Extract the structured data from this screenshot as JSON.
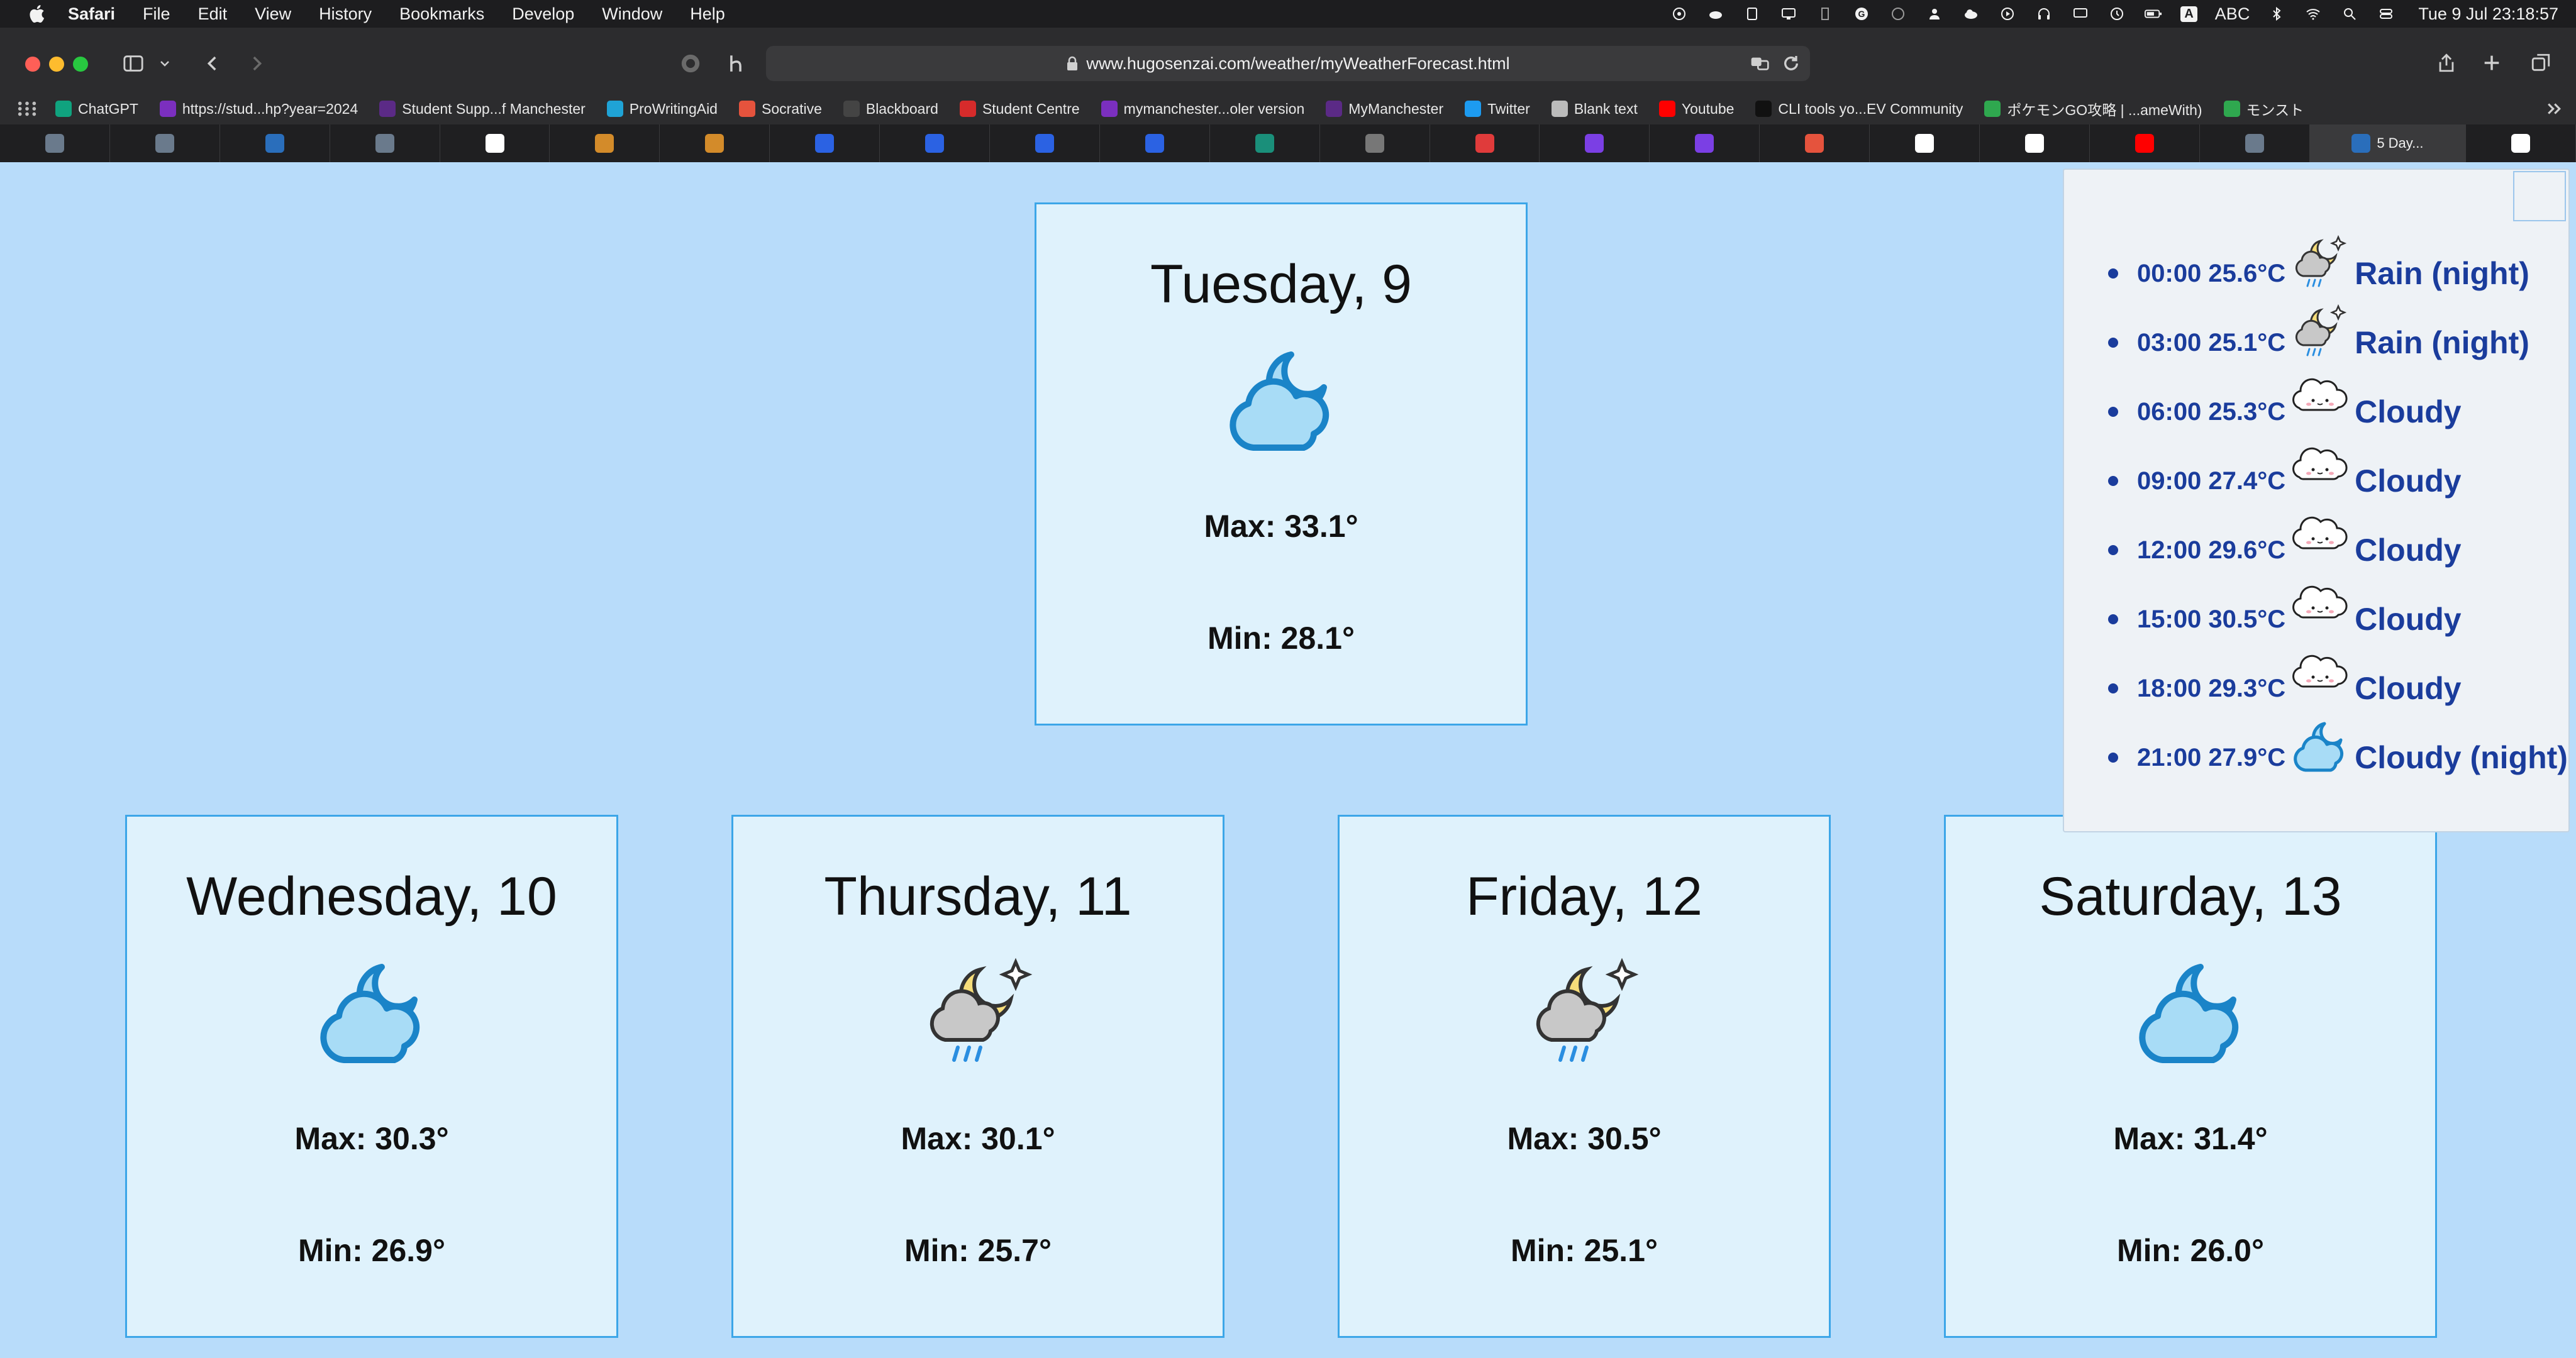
{
  "menubar": {
    "app_name": "Safari",
    "items": [
      "File",
      "Edit",
      "View",
      "History",
      "Bookmarks",
      "Develop",
      "Window",
      "Help"
    ],
    "input_source": "ABC",
    "clock": "Tue 9 Jul  23:18:57"
  },
  "browser": {
    "url": "www.hugosenzai.com/weather/myWeatherForecast.html",
    "active_tab_title": "5 Day..."
  },
  "bookmarks": [
    {
      "label": "ChatGPT",
      "icon": "chatgpt-icon",
      "color": "#10a37f"
    },
    {
      "label": "https://stud...hp?year=2024",
      "icon": "moodle-icon",
      "color": "#7b2fbf"
    },
    {
      "label": "Student Supp...f Manchester",
      "icon": "mymanchester-icon",
      "color": "#5b2a86"
    },
    {
      "label": "ProWritingAid",
      "icon": "prowritingaid-icon",
      "color": "#1fa3d6"
    },
    {
      "label": "Socrative",
      "icon": "socrative-icon",
      "color": "#e5533d"
    },
    {
      "label": "Blackboard",
      "icon": "blackboard-icon",
      "color": "#444444"
    },
    {
      "label": "Student Centre",
      "icon": "student-centre-icon",
      "color": "#d62b2b"
    },
    {
      "label": "mymanchester...oler version",
      "icon": "moodle-icon",
      "color": "#7b2fbf"
    },
    {
      "label": "MyManchester",
      "icon": "mymanchester-icon",
      "color": "#5b2a86"
    },
    {
      "label": "Twitter",
      "icon": "twitter-icon",
      "color": "#1d9bf0"
    },
    {
      "label": "Blank text",
      "icon": "blank-icon",
      "color": "#bbbbbb"
    },
    {
      "label": "Youtube",
      "icon": "youtube-icon",
      "color": "#ff0000"
    },
    {
      "label": "CLI tools yo...EV Community",
      "icon": "dev-icon",
      "color": "#111111"
    },
    {
      "label": "ポケモンGO攻略 | ...ameWith)",
      "icon": "gamewith-icon",
      "color": "#2fa84f"
    },
    {
      "label": "モンスト",
      "icon": "monst-icon",
      "color": "#2fa84f"
    }
  ],
  "tabs": [
    {
      "icon": "site-icon",
      "color": "#6a7a8c"
    },
    {
      "icon": "site-icon",
      "color": "#6a7a8c"
    },
    {
      "icon": "wordpress-icon",
      "color": "#2a6ebb"
    },
    {
      "icon": "site-icon",
      "color": "#6a7a8c"
    },
    {
      "icon": "google-icon",
      "color": "#ffffff"
    },
    {
      "icon": "stack-icon",
      "color": "#d38b2a"
    },
    {
      "icon": "stack-icon",
      "color": "#d38b2a"
    },
    {
      "icon": "c-icon",
      "color": "#2b62e3"
    },
    {
      "icon": "c-icon",
      "color": "#2b62e3"
    },
    {
      "icon": "c-icon",
      "color": "#2b62e3"
    },
    {
      "icon": "c-icon",
      "color": "#2b62e3"
    },
    {
      "icon": "xl-icon",
      "color": "#1a8f7a"
    },
    {
      "icon": "s-icon",
      "color": "#777777"
    },
    {
      "icon": "arrow-icon",
      "color": "#e03b3b"
    },
    {
      "icon": "arc-icon",
      "color": "#7b3fe4"
    },
    {
      "icon": "arc-icon",
      "color": "#7b3fe4"
    },
    {
      "icon": "tool-icon",
      "color": "#e5533d"
    },
    {
      "icon": "google-icon",
      "color": "#ffffff"
    },
    {
      "icon": "github-icon",
      "color": "#ffffff"
    },
    {
      "icon": "youtube-icon",
      "color": "#ff0000"
    },
    {
      "icon": "site-icon",
      "color": "#6a7a8c"
    }
  ],
  "forecast": {
    "max_prefix": "Max: ",
    "min_prefix": "Min: ",
    "days": [
      {
        "day": "Tuesday, 9",
        "max": "33.1°",
        "min": "28.1°",
        "icon": "cloudy-night-icon"
      },
      {
        "day": "Wednesday, 10",
        "max": "30.3°",
        "min": "26.9°",
        "icon": "cloudy-night-icon"
      },
      {
        "day": "Thursday, 11",
        "max": "30.1°",
        "min": "25.7°",
        "icon": "rain-night-icon"
      },
      {
        "day": "Friday, 12",
        "max": "30.5°",
        "min": "25.1°",
        "icon": "rain-night-icon"
      },
      {
        "day": "Saturday, 13",
        "max": "31.4°",
        "min": "26.0°",
        "icon": "cloudy-night-icon"
      }
    ]
  },
  "hourly": [
    {
      "time": "00:00 25.6°C",
      "desc": "Rain (night)",
      "icon": "rain-night-icon"
    },
    {
      "time": "03:00 25.1°C",
      "desc": "Rain (night)",
      "icon": "rain-night-icon"
    },
    {
      "time": "06:00 25.3°C",
      "desc": "Cloudy",
      "icon": "cloudy-icon"
    },
    {
      "time": "09:00 27.4°C",
      "desc": "Cloudy",
      "icon": "cloudy-icon"
    },
    {
      "time": "12:00 29.6°C",
      "desc": "Cloudy",
      "icon": "cloudy-icon"
    },
    {
      "time": "15:00 30.5°C",
      "desc": "Cloudy",
      "icon": "cloudy-icon"
    },
    {
      "time": "18:00 29.3°C",
      "desc": "Cloudy",
      "icon": "cloudy-icon"
    },
    {
      "time": "21:00 27.9°C",
      "desc": "Cloudy (night)",
      "icon": "cloudy-night-icon"
    }
  ],
  "colors": {
    "page_background": "#b8dcfa",
    "card_background": "#dff2fc",
    "card_border": "#3ca6e8",
    "hourly_text": "#1a3c9c"
  }
}
